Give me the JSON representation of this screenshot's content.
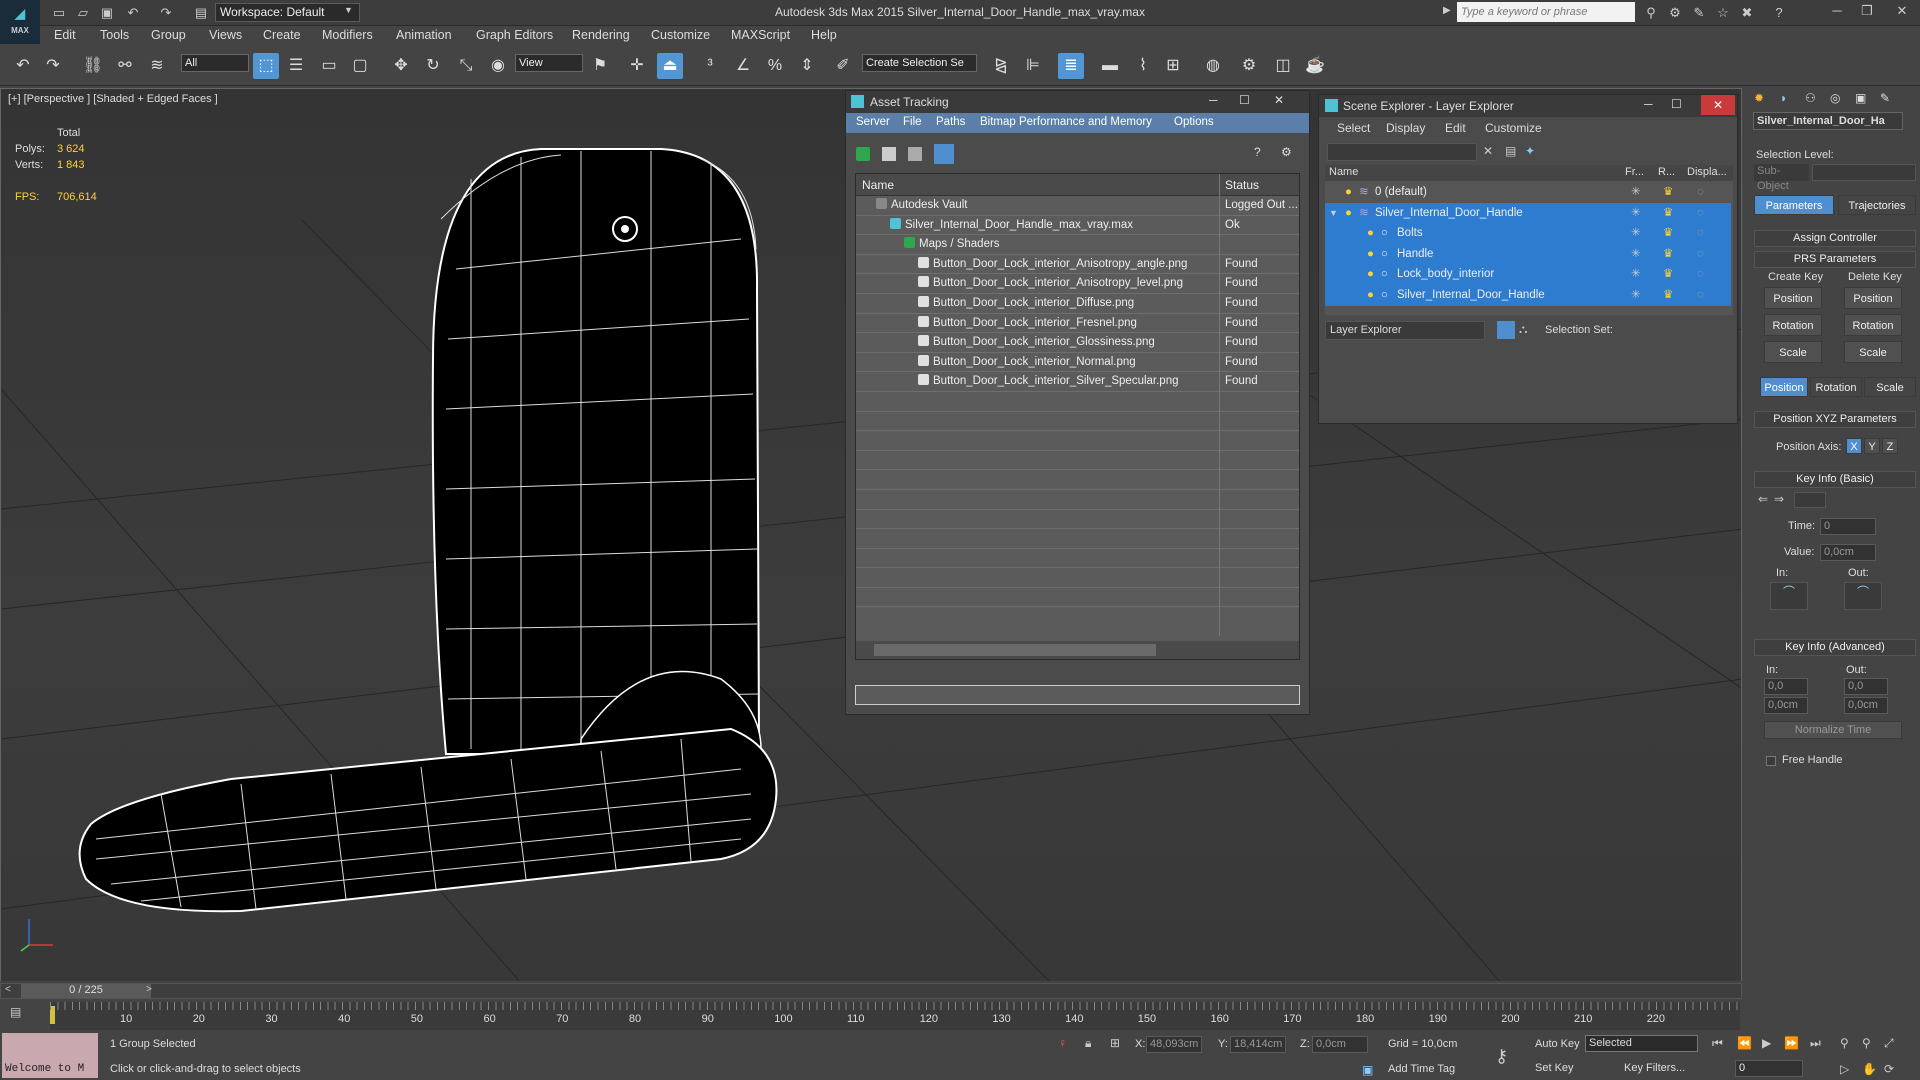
{
  "app": {
    "title": "Autodesk 3ds Max  2015    Silver_Internal_Door_Handle_max_vray.max",
    "logo_label": "MAX",
    "workspace": "Workspace: Default",
    "search_placeholder": "Type a keyword or phrase"
  },
  "menu": [
    "Edit",
    "Tools",
    "Group",
    "Views",
    "Create",
    "Modifiers",
    "Animation",
    "Graph Editors",
    "Rendering",
    "Customize",
    "MAXScript",
    "Help"
  ],
  "toolbar": {
    "selection_filter": "All",
    "ref_coord": "View",
    "named_selection": "Create Selection Se"
  },
  "viewport": {
    "label": "[+] [Perspective ] [Shaded + Edged Faces ]",
    "stats": {
      "total_label": "Total",
      "polys_label": "Polys:",
      "polys": "3 624",
      "verts_label": "Verts:",
      "verts": "1 843",
      "fps_label": "FPS:",
      "fps": "706,614"
    }
  },
  "asset_tracking": {
    "title": "Asset Tracking",
    "menu": [
      "Server",
      "File",
      "Paths",
      "Bitmap Performance and Memory",
      "Options"
    ],
    "col_name": "Name",
    "col_status": "Status",
    "rows": [
      {
        "name": "Autodesk Vault",
        "status": "Logged Out ...",
        "indent": 1,
        "icon": "vault"
      },
      {
        "name": "Silver_Internal_Door_Handle_max_vray.max",
        "status": "Ok",
        "indent": 2,
        "icon": "max"
      },
      {
        "name": "Maps / Shaders",
        "status": "",
        "indent": 3,
        "icon": "folder"
      },
      {
        "name": "Button_Door_Lock_interior_Anisotropy_angle.png",
        "status": "Found",
        "indent": 4,
        "icon": "img"
      },
      {
        "name": "Button_Door_Lock_interior_Anisotropy_level.png",
        "status": "Found",
        "indent": 4,
        "icon": "img"
      },
      {
        "name": "Button_Door_Lock_interior_Diffuse.png",
        "status": "Found",
        "indent": 4,
        "icon": "img"
      },
      {
        "name": "Button_Door_Lock_interior_Fresnel.png",
        "status": "Found",
        "indent": 4,
        "icon": "img"
      },
      {
        "name": "Button_Door_Lock_interior_Glossiness.png",
        "status": "Found",
        "indent": 4,
        "icon": "img"
      },
      {
        "name": "Button_Door_Lock_interior_Normal.png",
        "status": "Found",
        "indent": 4,
        "icon": "img"
      },
      {
        "name": "Button_Door_Lock_interior_Silver_Specular.png",
        "status": "Found",
        "indent": 4,
        "icon": "img"
      }
    ]
  },
  "scene_explorer": {
    "title": "Scene Explorer - Layer Explorer",
    "menu": [
      "Select",
      "Display",
      "Edit",
      "Customize"
    ],
    "col_name": "Name",
    "col_fr": "Fr...",
    "col_r": "R...",
    "col_disp": "Displa...",
    "rows": [
      {
        "name": "0 (default)",
        "selected": false,
        "indent": 0
      },
      {
        "name": "Silver_Internal_Door_Handle",
        "selected": true,
        "indent": 0
      },
      {
        "name": "Bolts",
        "selected": true,
        "indent": 1
      },
      {
        "name": "Handle",
        "selected": true,
        "indent": 1
      },
      {
        "name": "Lock_body_interior",
        "selected": true,
        "indent": 1
      },
      {
        "name": "Silver_Internal_Door_Handle",
        "selected": true,
        "indent": 1
      }
    ],
    "footer_combo": "Layer Explorer",
    "selection_set_label": "Selection Set:"
  },
  "command_panel": {
    "object_name": "Silver_Internal_Door_Ha",
    "selection_level_label": "Selection Level:",
    "sub_object": "Sub-Object",
    "tab_parameters": "Parameters",
    "tab_trajectories": "Trajectories",
    "assign_controller": "Assign Controller",
    "prs_parameters": "PRS Parameters",
    "create_key": "Create Key",
    "delete_key": "Delete Key",
    "position": "Position",
    "rotation": "Rotation",
    "scale": "Scale",
    "pos_xyz": "Position XYZ Parameters",
    "position_axis": "Position Axis:",
    "axes": [
      "X",
      "Y",
      "Z"
    ],
    "key_info_basic": "Key Info (Basic)",
    "time_label": "Time:",
    "time_value": "0",
    "value_label": "Value:",
    "value_value": "0,0cm",
    "in_label": "In:",
    "out_label": "Out:",
    "key_info_adv": "Key Info (Advanced)",
    "adv_in": "0,0",
    "adv_out": "0,0",
    "adv_in_cm": "0,0cm",
    "adv_out_cm": "0,0cm",
    "normalize_time": "Normalize Time",
    "free_handle": "Free Handle"
  },
  "timeline": {
    "frame_counter": "0 / 225",
    "ticks": [
      "10",
      "20",
      "30",
      "40",
      "50",
      "60",
      "70",
      "80",
      "90",
      "100",
      "110",
      "120",
      "130",
      "140",
      "150",
      "160",
      "170",
      "180",
      "190",
      "200",
      "210",
      "220"
    ]
  },
  "status": {
    "welcome": "Welcome to M",
    "selection": "1 Group Selected",
    "prompt": "Click or click-and-drag to select objects",
    "x_label": "X:",
    "x": "48,093cm",
    "y_label": "Y:",
    "y": "18,414cm",
    "z_label": "Z:",
    "z": "0,0cm",
    "grid": "Grid = 10,0cm",
    "add_time_tag": "Add Time Tag",
    "auto_key": "Auto Key",
    "set_key": "Set Key",
    "selected": "Selected",
    "key_filters": "Key Filters...",
    "frame": "0"
  }
}
